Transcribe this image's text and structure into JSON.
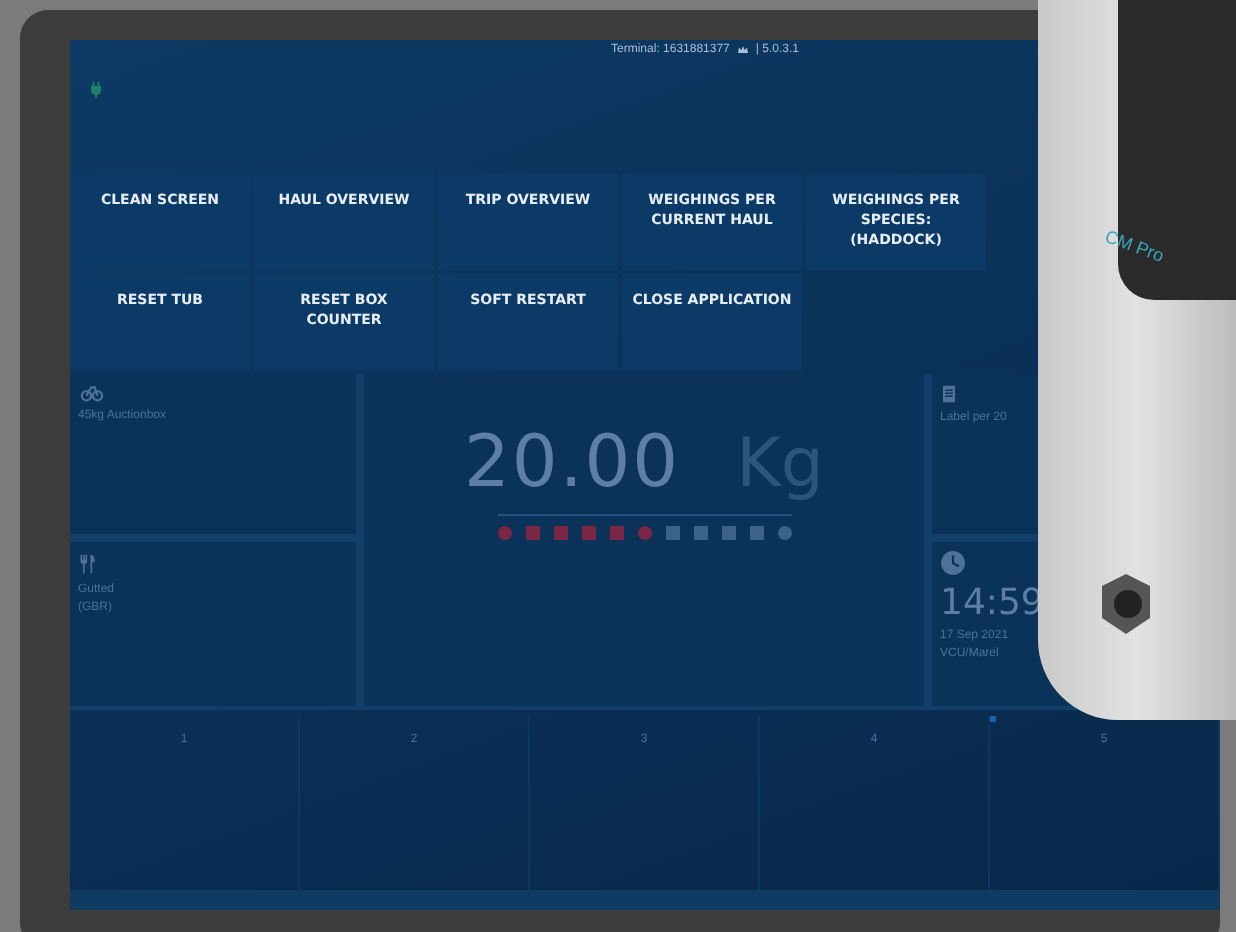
{
  "status_bar": {
    "terminal": "Terminal: 1631881377",
    "version": "| 5.0.3.1"
  },
  "menu": {
    "rows": [
      [
        {
          "label": "CLEAN SCREEN"
        },
        {
          "label": "HAUL OVERVIEW"
        },
        {
          "label": "TRIP OVERVIEW"
        },
        {
          "label": "WEIGHINGS PER CURRENT HAUL"
        },
        {
          "label": "WEIGHINGS PER SPECIES: (HADDOCK)"
        }
      ],
      [
        {
          "label": "RESET TUB"
        },
        {
          "label": "RESET BOX COUNTER"
        },
        {
          "label": "SOFT RESTART"
        },
        {
          "label": "CLOSE APPLICATION"
        }
      ]
    ]
  },
  "dashboard": {
    "box": {
      "name": "45kg Auctionbox"
    },
    "processing": {
      "lines": [
        "Gutted",
        "(GBR)"
      ]
    },
    "weight": {
      "value": "20.00",
      "unit": "Kg",
      "indicator": [
        {
          "kind": "circle",
          "lit": true
        },
        {
          "kind": "square",
          "lit": true
        },
        {
          "kind": "square",
          "lit": true
        },
        {
          "kind": "square",
          "lit": true
        },
        {
          "kind": "square",
          "lit": true
        },
        {
          "kind": "circle",
          "lit": true
        },
        {
          "kind": "square",
          "lit": false
        },
        {
          "kind": "square",
          "lit": false
        },
        {
          "kind": "square",
          "lit": false
        },
        {
          "kind": "square",
          "lit": false
        },
        {
          "kind": "circle",
          "lit": false
        }
      ]
    },
    "label": {
      "text": "Label per 20"
    },
    "clock": {
      "time": "14:59",
      "date": "17 Sep 2021",
      "source": "VCU/Marel"
    }
  },
  "slots": [
    "1",
    "2",
    "3",
    "4",
    "5"
  ],
  "device_label": "CM Pro"
}
